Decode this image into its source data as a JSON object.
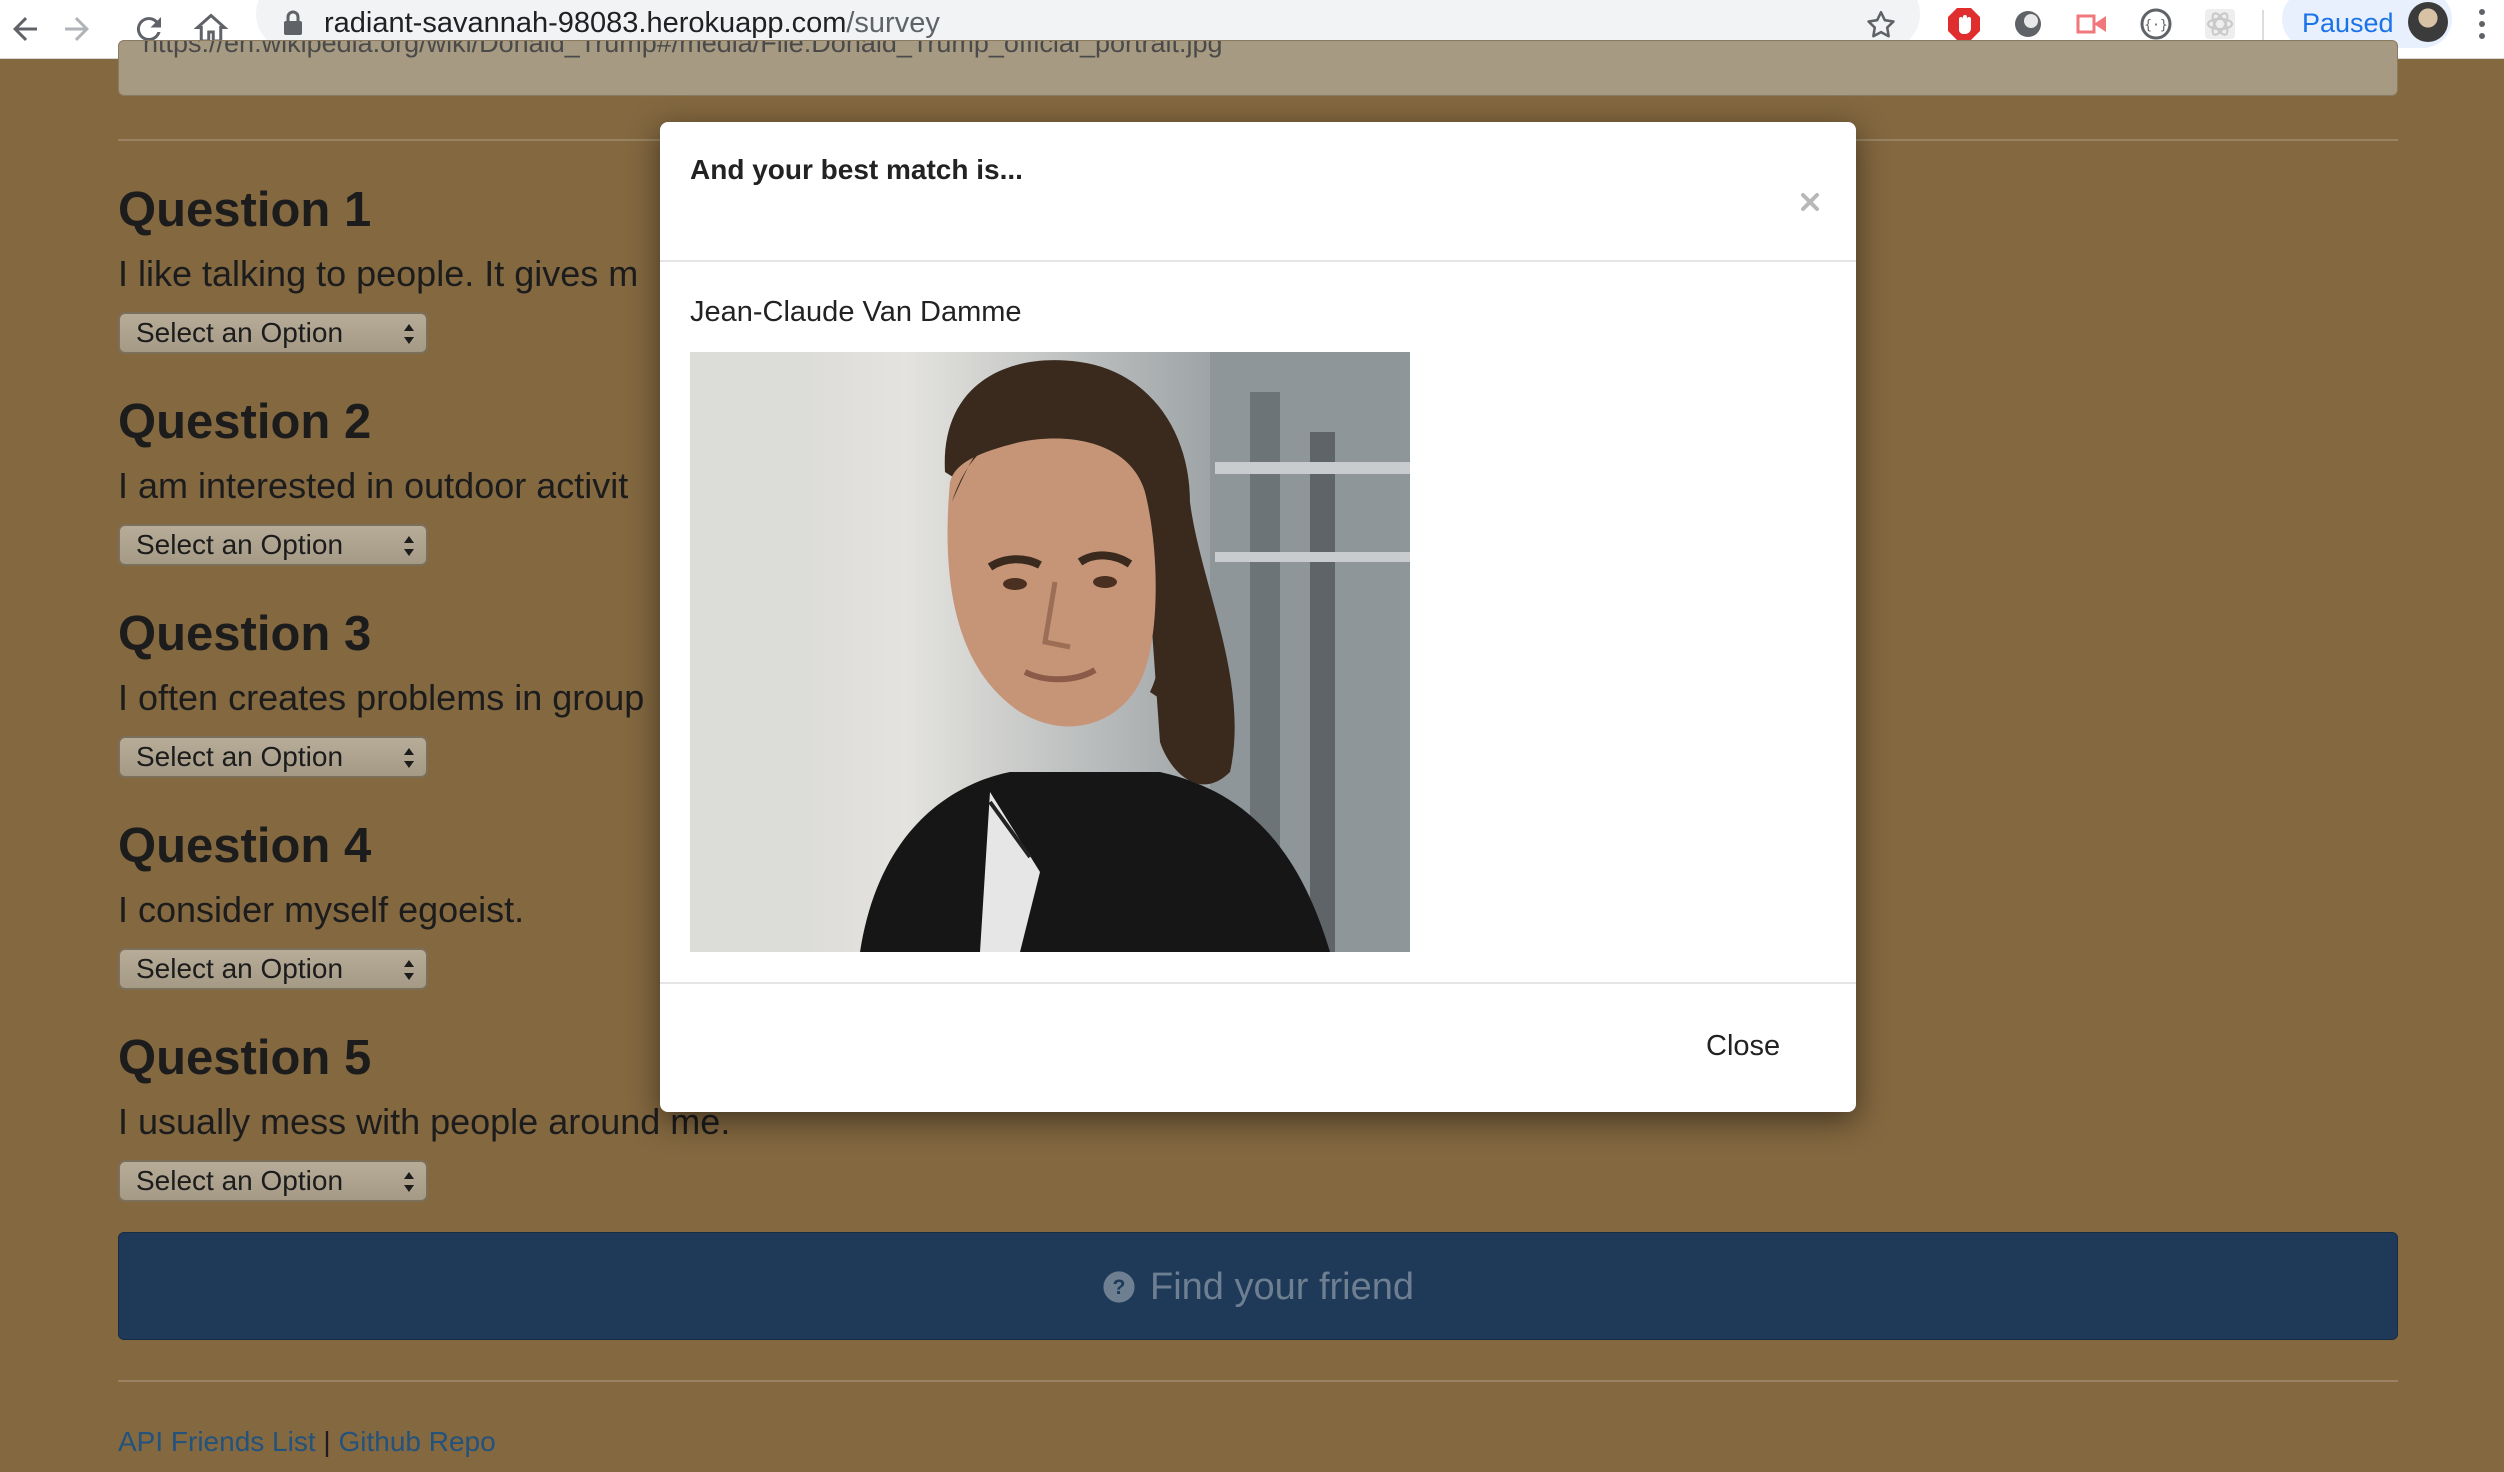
{
  "browser": {
    "url_host": "radiant-savannah-98083.herokuapp.com",
    "url_path": "/survey",
    "profile_label": "Paused"
  },
  "page": {
    "previous_field_value": "https://en.wikipedia.org/wiki/Donald_Trump#/media/File:Donald_Trump_official_portrait.jpg",
    "questions": [
      {
        "title": "Question 1",
        "text": "I like talking to people. It gives m",
        "select": "Select an Option"
      },
      {
        "title": "Question 2",
        "text": "I am interested in outdoor activit",
        "select": "Select an Option"
      },
      {
        "title": "Question 3",
        "text": "I often creates problems in group",
        "select": "Select an Option"
      },
      {
        "title": "Question 4",
        "text": "I consider myself egoeist.",
        "select": "Select an Option"
      },
      {
        "title": "Question 5",
        "text": "I usually mess with people around me.",
        "select": "Select an Option"
      }
    ],
    "submit_label": "Find your friend",
    "footer": {
      "link1": "API Friends List",
      "separator": "|",
      "link2": "Github Repo"
    }
  },
  "modal": {
    "title": "And your best match is...",
    "match_name": "Jean-Claude Van Damme",
    "close_label": "Close",
    "close_icon": "×"
  },
  "icons": {
    "back": "arrow-left-icon",
    "forward": "arrow-right-icon",
    "reload": "reload-icon",
    "home": "home-icon",
    "lock": "lock-icon",
    "bookmark": "star-icon",
    "submit": "question-circle-icon"
  },
  "colors": {
    "page_background": "#836840",
    "button_primary": "#1f3a58",
    "link": "#23527c",
    "profile_accent": "#1a73e8"
  }
}
